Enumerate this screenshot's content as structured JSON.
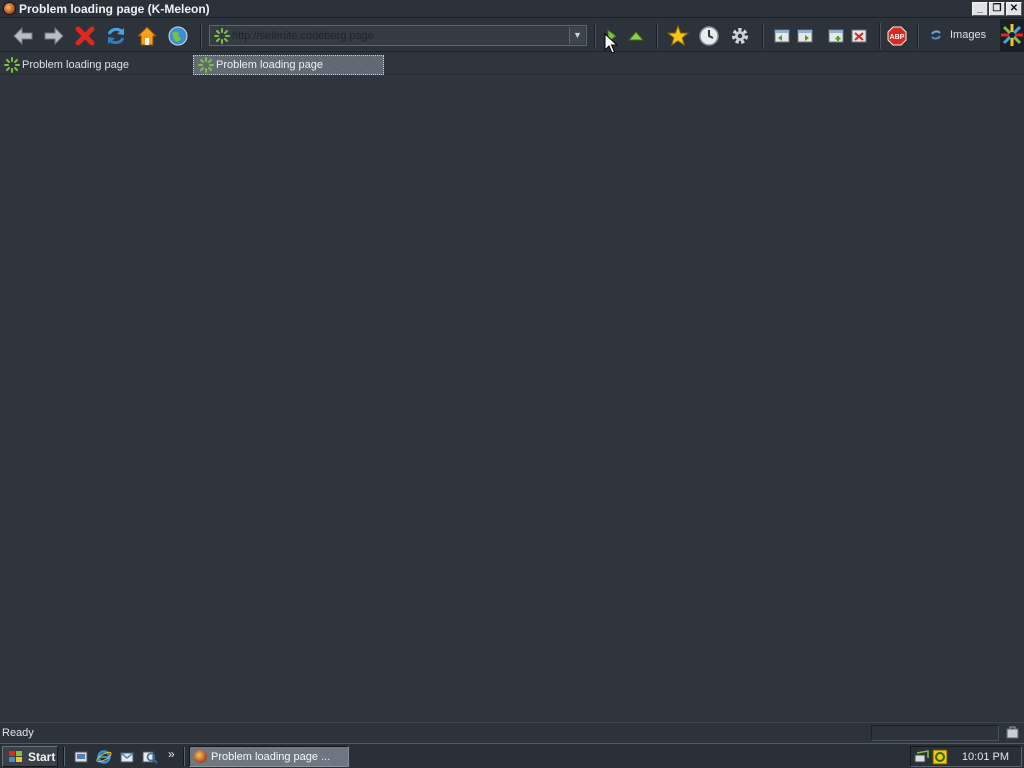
{
  "window": {
    "title": "Problem loading page (K-Meleon)"
  },
  "toolbar": {
    "url": "http://selenite.codeberg.page",
    "images_label": "Images"
  },
  "tabs": [
    {
      "label": "Problem loading page"
    },
    {
      "label": "Problem loading page"
    }
  ],
  "status": {
    "text": "Ready"
  },
  "taskbar": {
    "start_label": "Start",
    "chevron": "»",
    "task_label": "Problem loading page ...",
    "clock": "10:01 PM"
  },
  "icons": {
    "back": "back-arrow-icon",
    "forward": "forward-arrow-icon",
    "stop": "stop-icon",
    "reload": "reload-icon",
    "home": "home-icon",
    "globe": "globe-icon",
    "go": "go-icon",
    "up": "up-icon",
    "bookmarks": "star-icon",
    "history": "clock-icon",
    "settings": "gear-icon",
    "adblock": "adblock-icon"
  },
  "colors": {
    "background": "#2f353d",
    "accent_green": "#7cc242",
    "stop_red": "#e0281e",
    "star_yellow": "#f5c518"
  }
}
